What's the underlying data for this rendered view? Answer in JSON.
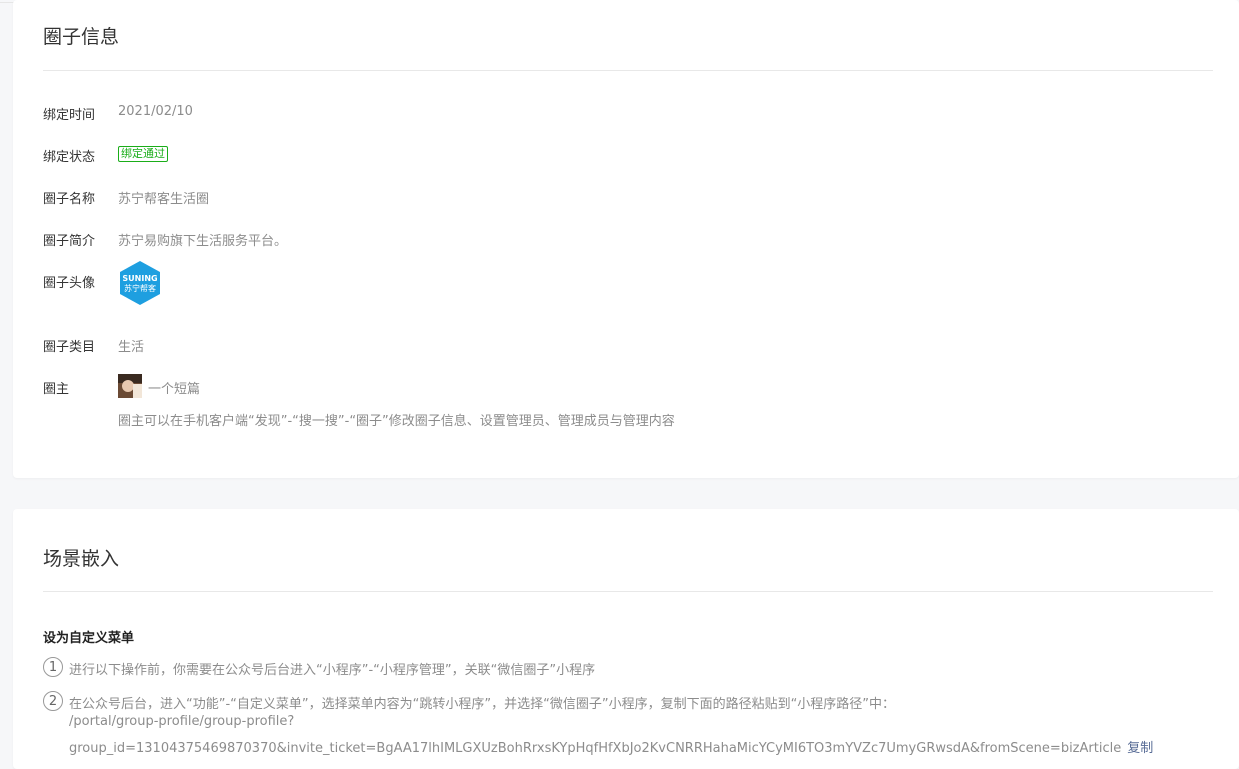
{
  "circle_info": {
    "title": "圈子信息",
    "bind_time_label": "绑定时间",
    "bind_time_value": "2021/02/10",
    "bind_status_label": "绑定状态",
    "bind_status_value": "绑定通过",
    "name_label": "圈子名称",
    "name_value": "苏宁帮客生活圈",
    "intro_label": "圈子简介",
    "intro_value": "苏宁易购旗下生活服务平台。",
    "avatar_label": "圈子头像",
    "avatar_text_top": "SUNING",
    "avatar_text_bottom": "苏宁帮客",
    "category_label": "圈子类目",
    "category_value": "生活",
    "owner_label": "圈主",
    "owner_name": "一个短篇",
    "owner_hint": "圈主可以在手机客户端“发现”-“搜一搜”-“圈子”修改圈子信息、设置管理员、管理成员与管理内容"
  },
  "scene": {
    "title": "场景嵌入",
    "section_title": "设为自定义菜单",
    "step1_num": "1",
    "step1_text": "进行以下操作前，你需要在公众号后台进入“小程序”-“小程序管理”，关联“微信圈子”小程序",
    "step2_num": "2",
    "step2_text": "在公众号后台，进入“功能”-“自定义菜单”，选择菜单内容为“跳转小程序”，并选择“微信圈子”小程序，复制下面的路径粘贴到“小程序路径”中：",
    "path_line1": "/portal/group-profile/group-profile?",
    "path_line2": "group_id=13104375469870370&invite_ticket=BgAA17lhIMLGXUzBohRrxsKYpHqfHfXbJo2KvCNRRHahaMicYCyMI6TO3mYVZc7UmyGRwsdA&fromScene=bizArticle",
    "copy_label": "复制"
  },
  "colors": {
    "badge_green": "#1aad19",
    "link_blue": "#576b95",
    "avatar_blue": "#1e9fe0"
  }
}
